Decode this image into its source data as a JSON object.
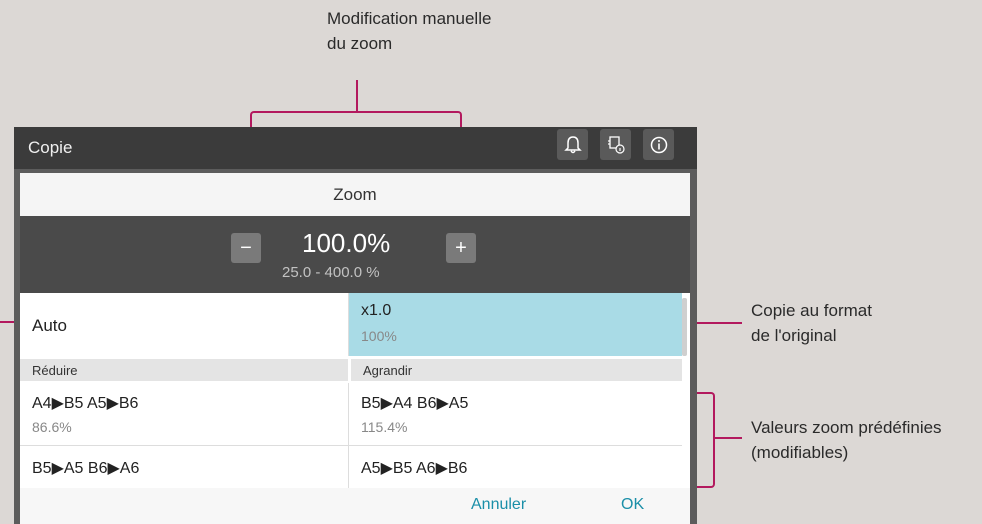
{
  "annotations": {
    "zoom_manual_line1": "Modification manuelle",
    "zoom_manual_line2": "du zoom",
    "copy_original_line1": "Copie au format",
    "copy_original_line2": "de l'original",
    "presets_line1": "Valeurs zoom prédéfinies",
    "presets_line2": "(modifiables)"
  },
  "window": {
    "title": "Copie"
  },
  "titlebar_icons": [
    "bell-icon",
    "job-status-icon",
    "info-icon"
  ],
  "dialog": {
    "title": "Zoom",
    "zoom_value": "100.0%",
    "zoom_range": "25.0  -  400.0  %",
    "minus_label": "−",
    "plus_label": "+",
    "auto_label": "Auto",
    "original": {
      "main": "x1.0",
      "sub": "100%"
    },
    "reduce_header": "Réduire",
    "enlarge_header": "Agrandir",
    "reduce_items": [
      {
        "main": "A4▶B5  A5▶B6",
        "sub": "86.6%"
      },
      {
        "main": "B5▶A5  B6▶A6",
        "sub": ""
      }
    ],
    "enlarge_items": [
      {
        "main": "B5▶A4  B6▶A5",
        "sub": "115.4%"
      },
      {
        "main": "A5▶B5  A6▶B6",
        "sub": ""
      }
    ],
    "cancel_label": "Annuler",
    "ok_label": "OK"
  },
  "colors": {
    "accent": "#b3195e",
    "selected": "#a9dbe6",
    "link": "#1a8fa8"
  }
}
